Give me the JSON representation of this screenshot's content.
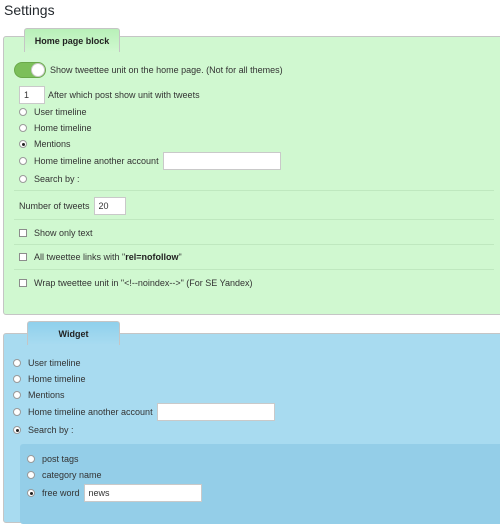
{
  "page": {
    "title": "Settings"
  },
  "home_block": {
    "tab_label": "Home page block",
    "show_unit_label": "Show tweettee unit on the home page. (Not for all themes)",
    "show_unit_enabled": true,
    "after_post_value": "1",
    "after_post_label": "After which post show unit with tweets",
    "radios": [
      {
        "label": "User timeline",
        "checked": false
      },
      {
        "label": "Home timeline",
        "checked": false
      },
      {
        "label": "Mentions",
        "checked": true
      },
      {
        "label": "Home timeline another account",
        "checked": false
      },
      {
        "label": "Search by :",
        "checked": false
      }
    ],
    "another_account_value": "",
    "tweets_count_label": "Number of tweets",
    "tweets_count_value": "20",
    "only_text_label": "Show only text",
    "nofollow_label_prefix": "All tweettee links with \"",
    "nofollow_label_bold": "rel=nofollow",
    "nofollow_label_suffix": "\"",
    "noindex_label": "Wrap tweettee unit in \"<!--noindex-->\" (For SE Yandex)"
  },
  "widget": {
    "tab_label": "Widget",
    "radios": [
      {
        "label": "User timeline",
        "checked": false
      },
      {
        "label": "Home timeline",
        "checked": false
      },
      {
        "label": "Mentions",
        "checked": false
      },
      {
        "label": "Home timeline another account",
        "checked": false
      },
      {
        "label": "Search by :",
        "checked": true
      }
    ],
    "another_account_value": "",
    "search_options": [
      {
        "label": "post tags",
        "checked": false
      },
      {
        "label": "category name",
        "checked": false
      },
      {
        "label": "free word",
        "checked": true
      }
    ],
    "free_word_value": "news"
  },
  "colors": {
    "home_panel_bg": "#d0f8d0",
    "widget_panel_bg": "#a8dbf0",
    "toggle_on": "#7cbf5a"
  }
}
